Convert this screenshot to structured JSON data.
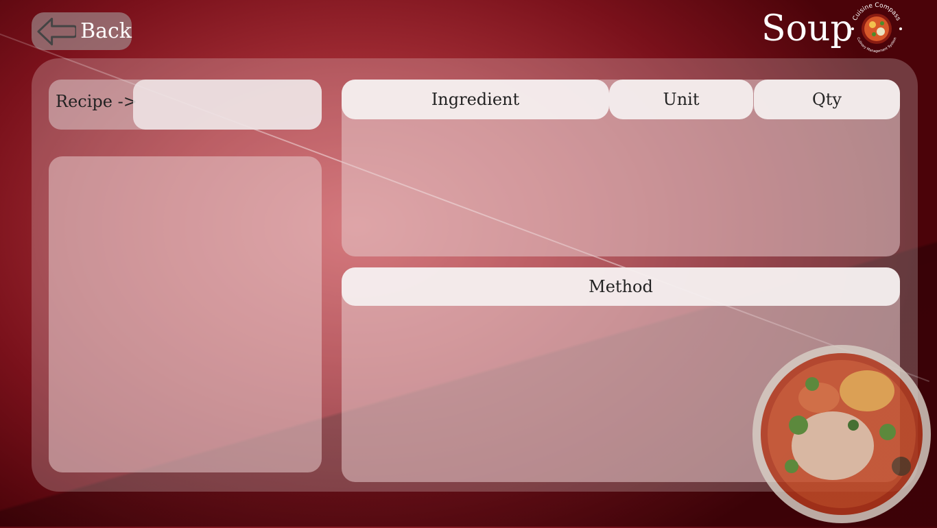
{
  "header": {
    "back_label": "Back",
    "page_title": "Soup",
    "logo_top_text": "Cuisine Compass",
    "logo_bottom_text": "Culinary Management System"
  },
  "recipe": {
    "label": "Recipe ->",
    "input_value": ""
  },
  "ingredients_table": {
    "columns": [
      "Ingredient",
      "Unit",
      "Qty"
    ],
    "rows": []
  },
  "method": {
    "heading": "Method",
    "text": ""
  },
  "colors": {
    "background_center": "#c9545a",
    "background_edge": "#4b0309",
    "panel_overlay": "rgba(255,255,255,0.22)",
    "header_cell": "#f5f0f0"
  },
  "icons": [
    "back-arrow-icon",
    "cuisine-compass-logo",
    "soup-bowl-image"
  ]
}
